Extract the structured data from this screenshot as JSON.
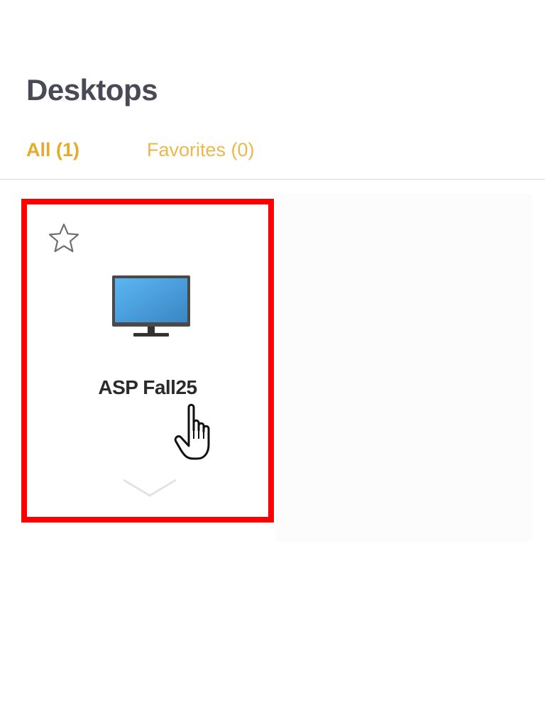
{
  "header": {
    "title": "Desktops"
  },
  "tabs": [
    {
      "label": "All (1)",
      "active": true
    },
    {
      "label": "Favorites (0)",
      "active": false
    }
  ],
  "desktops": [
    {
      "name": "ASP Fall25",
      "favorite": false,
      "icon": "monitor-icon",
      "selected": true
    }
  ],
  "colors": {
    "accent": "#e4ac2c",
    "selection_border": "#ff0000",
    "title": "#4a4a57",
    "divider": "#d9d9d9"
  },
  "icons": [
    "star-outline-icon",
    "monitor-icon",
    "chevron-down-icon",
    "hand-pointer-cursor-icon"
  ]
}
